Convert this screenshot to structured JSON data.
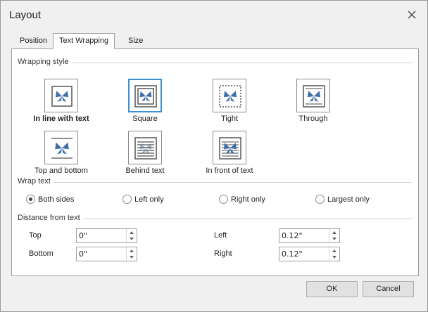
{
  "window": {
    "title": "Layout"
  },
  "tabs": [
    {
      "label": "Position",
      "active": false
    },
    {
      "label": "Text Wrapping",
      "active": true
    },
    {
      "label": "Size",
      "active": false
    }
  ],
  "wrapping_style": {
    "group_label": "Wrapping style",
    "options": [
      {
        "label": "In line with text",
        "icon": "inline-with-text-icon",
        "bold": true
      },
      {
        "label": "Square",
        "icon": "square-wrap-icon",
        "selected": true
      },
      {
        "label": "Tight",
        "icon": "tight-wrap-icon"
      },
      {
        "label": "Through",
        "icon": "through-wrap-icon"
      },
      {
        "label": "Top and bottom",
        "icon": "top-and-bottom-wrap-icon"
      },
      {
        "label": "Behind text",
        "icon": "behind-text-icon"
      },
      {
        "label": "In front of text",
        "icon": "in-front-of-text-icon"
      }
    ]
  },
  "wrap_text": {
    "group_label": "Wrap text",
    "options": [
      {
        "label": "Both sides",
        "checked": true
      },
      {
        "label": "Left only",
        "checked": false
      },
      {
        "label": "Right only",
        "checked": false
      },
      {
        "label": "Largest only",
        "checked": false
      }
    ]
  },
  "distance": {
    "group_label": "Distance from text",
    "top_label": "Top",
    "top_value": "0\"",
    "bottom_label": "Bottom",
    "bottom_value": "0\"",
    "left_label": "Left",
    "left_value": "0.12\"",
    "right_label": "Right",
    "right_value": "0.12\""
  },
  "buttons": {
    "ok": "OK",
    "cancel": "Cancel"
  },
  "colors": {
    "accent": "#3c8fd0",
    "butterfly": "#3f6fa8",
    "text_lines": "#6d6d6d"
  }
}
